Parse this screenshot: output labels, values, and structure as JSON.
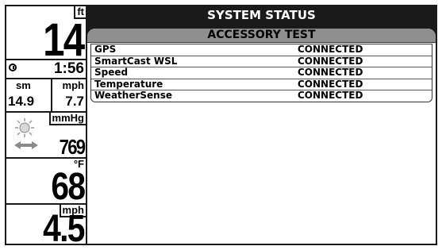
{
  "screen": {
    "title": "SYSTEM STATUS"
  },
  "left_panel": {
    "depth": {
      "unit": "ft",
      "value": "14"
    },
    "time": {
      "icon": "clock-icon",
      "value": "1:56"
    },
    "distance": {
      "unit": "sm",
      "value": "14.9"
    },
    "speed_small": {
      "unit": "mph",
      "value": "7.7"
    },
    "pressure": {
      "unit": "mmHg",
      "value": "769",
      "weather_icon": "sun-icon",
      "trend_icon": "double-arrow-icon"
    },
    "temperature": {
      "unit": "°F",
      "value": "68"
    },
    "speed": {
      "unit": "mph",
      "value": "4.5"
    }
  },
  "accessory_test": {
    "heading": "ACCESSORY TEST",
    "items": [
      {
        "name": "GPS",
        "status": "CONNECTED"
      },
      {
        "name": "SmartCast WSL",
        "status": "CONNECTED"
      },
      {
        "name": "Speed",
        "status": "CONNECTED"
      },
      {
        "name": "Temperature",
        "status": "CONNECTED"
      },
      {
        "name": "WeatherSense",
        "status": "CONNECTED"
      }
    ]
  },
  "colors": {
    "frame": "#1a1a1a",
    "header_bar": "#8f8f8f",
    "background": "#ffffff"
  }
}
